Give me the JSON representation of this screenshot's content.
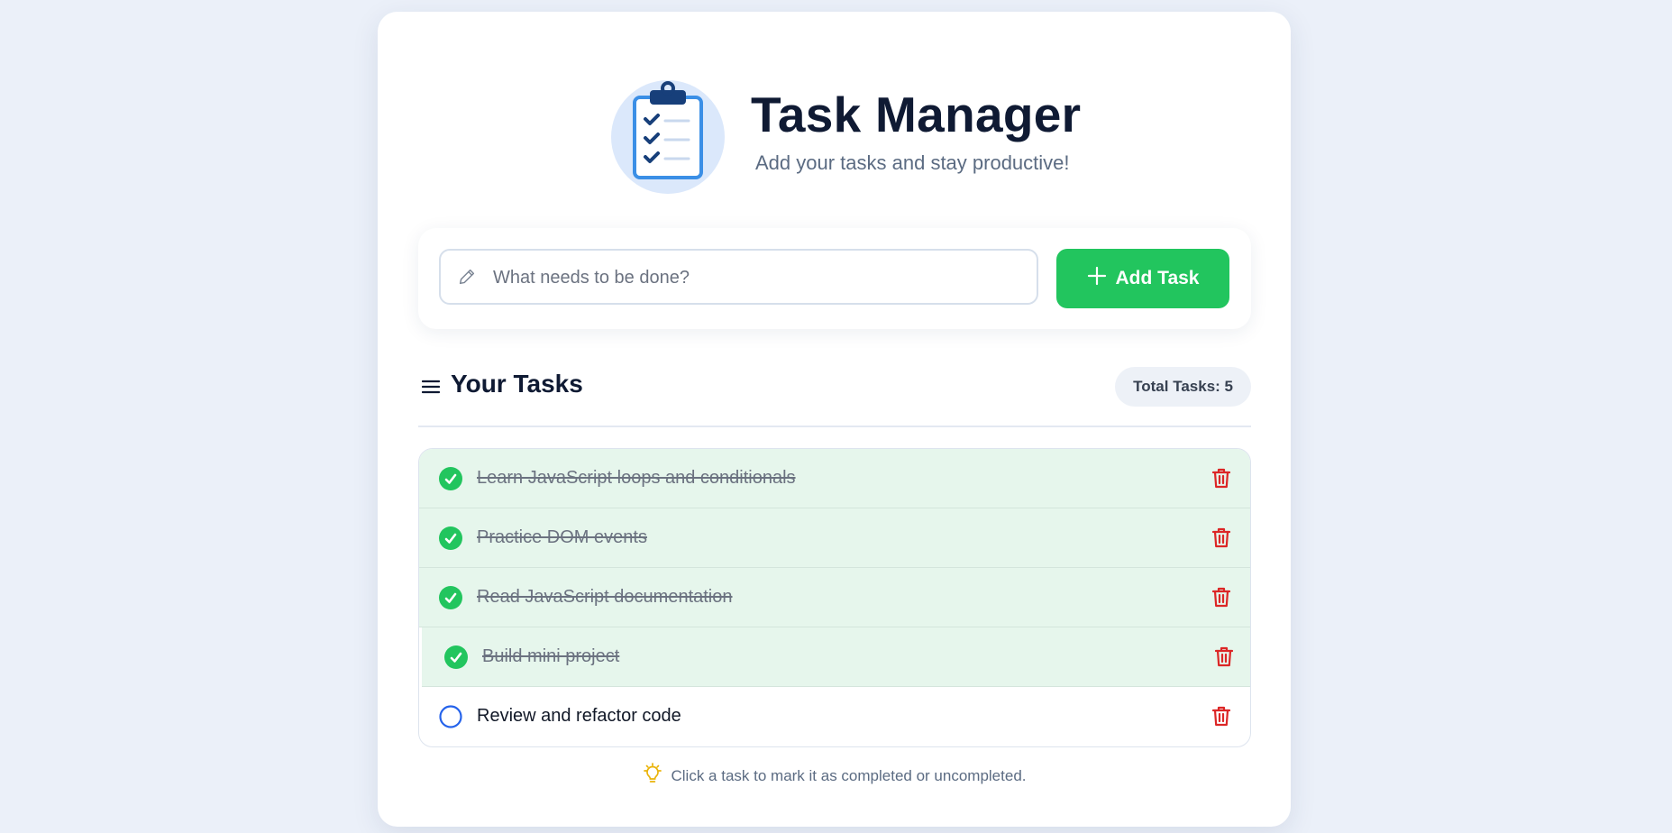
{
  "header": {
    "title": "Task Manager",
    "subtitle": "Add your tasks and stay productive!",
    "logo_icon": "clipboard-checklist-icon"
  },
  "input": {
    "placeholder": "What needs to be done?",
    "value": "",
    "icon": "pencil-icon"
  },
  "add_button": {
    "label": "Add Task",
    "icon": "plus-icon"
  },
  "list": {
    "title": "Your Tasks",
    "icon": "menu-icon",
    "total_label": "Total Tasks: 5"
  },
  "tasks": [
    {
      "text": "Learn JavaScript loops and conditionals",
      "completed": true
    },
    {
      "text": "Practice DOM events",
      "completed": true
    },
    {
      "text": "Read JavaScript documentation",
      "completed": true
    },
    {
      "text": "Build mini project",
      "completed": true
    },
    {
      "text": "Review and refactor code",
      "completed": false
    }
  ],
  "hint": {
    "text": "Click a task to mark it as completed or uncompleted.",
    "icon": "lightbulb-icon"
  },
  "colors": {
    "accent_green": "#22c55e",
    "delete_red": "#dc2626",
    "todo_circle": "#2563eb",
    "done_row_bg": "#e6f6ec",
    "page_bg": "#ebf0f9"
  }
}
